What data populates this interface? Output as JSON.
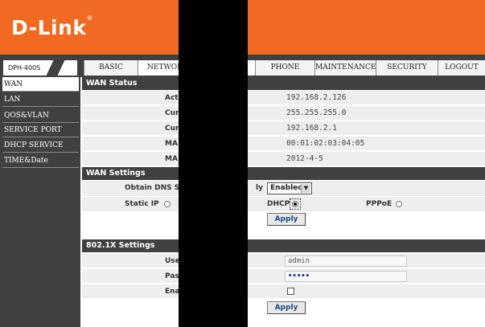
{
  "brand": {
    "logo": "D-Link",
    "trademark": "®"
  },
  "nav": {
    "model": "DPH-400S",
    "tabs": [
      {
        "label": "BASIC",
        "active": false
      },
      {
        "label": "NETWORK",
        "active": true
      },
      {
        "label": "PHONE",
        "active": false
      },
      {
        "label": "MAINTENANCE",
        "active": false
      },
      {
        "label": "SECURITY",
        "active": false
      },
      {
        "label": "LOGOUT",
        "active": false
      }
    ]
  },
  "sidebar": {
    "items": [
      {
        "label": "WAN",
        "active": true
      },
      {
        "label": "LAN",
        "active": false
      },
      {
        "label": "QOS&VLAN",
        "active": false
      },
      {
        "label": "SERVICE PORT",
        "active": false
      },
      {
        "label": "DHCP SERVICE",
        "active": false
      },
      {
        "label": "TIME&Date",
        "active": false
      }
    ]
  },
  "wan_status": {
    "title": "WAN Status",
    "rows": [
      {
        "label": "Act",
        "value": "192.168.2.126"
      },
      {
        "label": "Cur",
        "value": "255.255.255.0"
      },
      {
        "label": "Cur",
        "value": "192.168.2.1"
      },
      {
        "label": "MA",
        "value": "00:01:02:03:04:05"
      },
      {
        "label": "MA",
        "value": "2012-4-5"
      }
    ]
  },
  "wan_settings": {
    "title": "WAN Settings",
    "dns_label_left": "Obtain DNS Se",
    "dns_label_right": "ly",
    "dns_select": "Enabled",
    "static_ip_label": "Static IP",
    "dhcp_label": "DHCP",
    "pppoe_label": "PPPoE",
    "apply_label": "Apply"
  },
  "dot1x": {
    "title": "802.1X Settings",
    "user_label": "Use",
    "user_value": "admin",
    "pass_label": "Pas",
    "pass_value": "•••••",
    "enable_label": "Ena",
    "apply_label": "Apply"
  },
  "colors": {
    "brand_orange": "#f26a21",
    "dark_gray": "#404040"
  }
}
